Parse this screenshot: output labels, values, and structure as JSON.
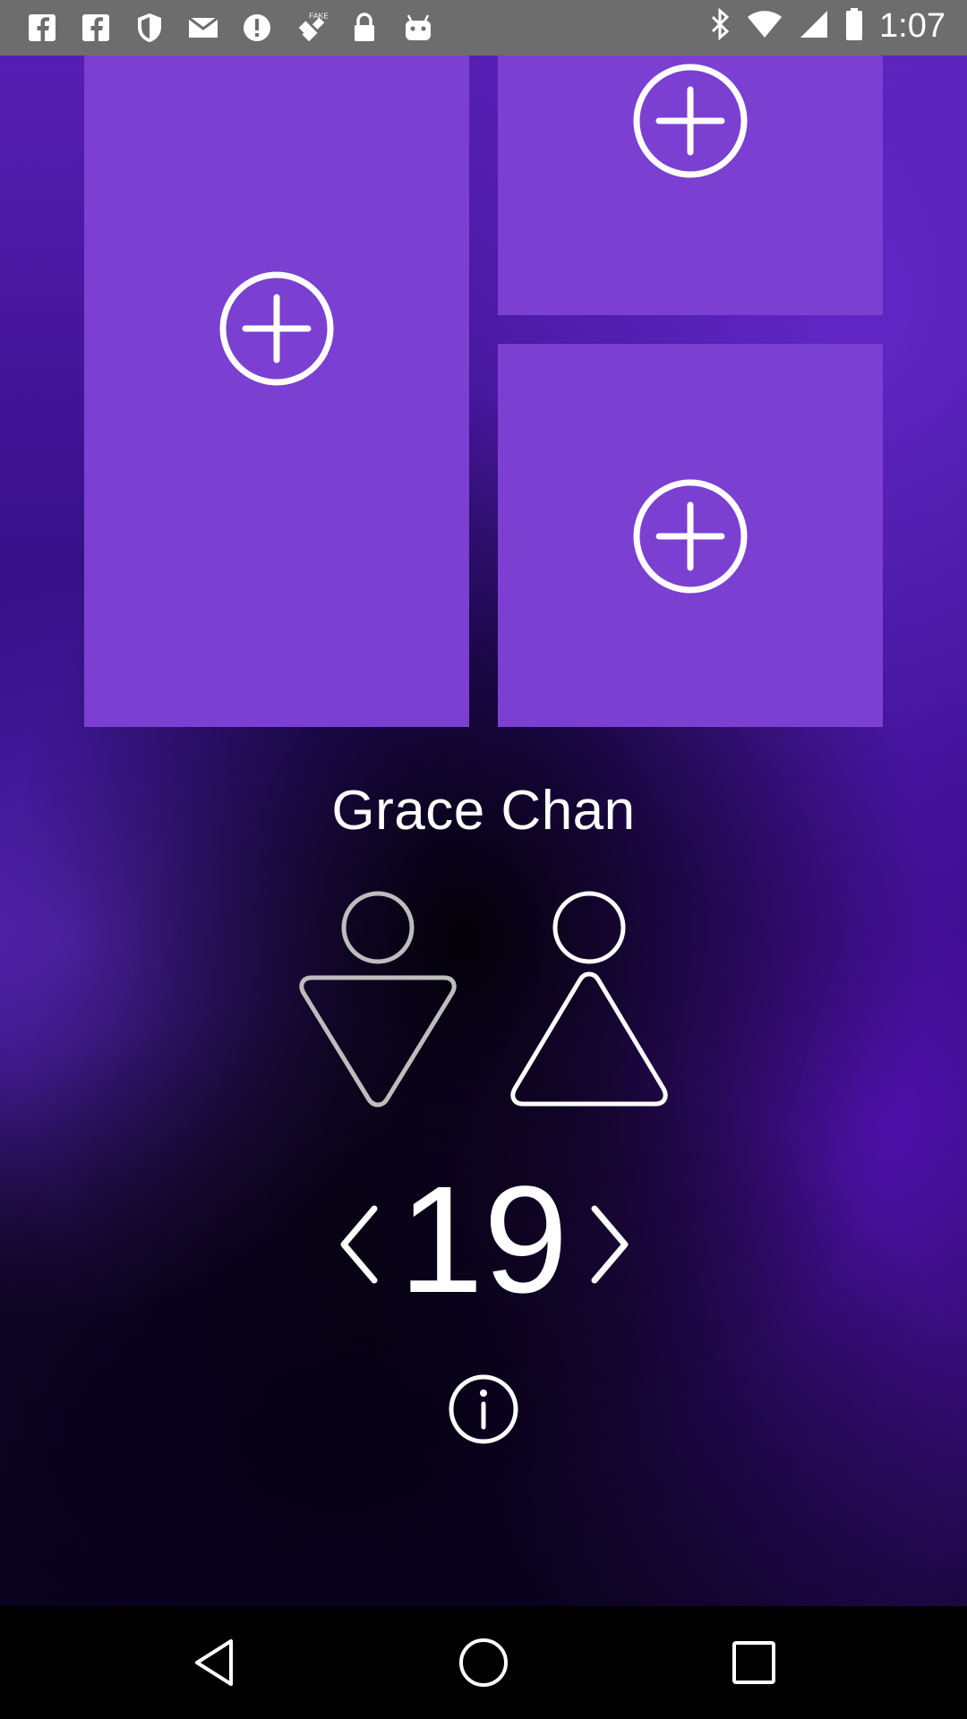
{
  "status_bar": {
    "time": "1:07",
    "left_icons": [
      "facebook-icon",
      "facebook-icon",
      "shield-icon",
      "mail-icon",
      "alert-icon",
      "fake-gps-icon",
      "lock-icon",
      "android-icon"
    ],
    "right_icons": [
      "bluetooth-icon",
      "wifi-icon",
      "signal-icon",
      "battery-icon"
    ]
  },
  "photos": {
    "slots": [
      "add-photo",
      "add-photo",
      "add-photo"
    ]
  },
  "profile": {
    "name": "Grace Chan",
    "gender_options": [
      "male",
      "female"
    ],
    "age": "19"
  },
  "colors": {
    "tile": "#7b3fd2",
    "text": "#ffffff",
    "status_bar": "#6d6d6d"
  },
  "nav": {
    "buttons": [
      "back",
      "home",
      "recent"
    ]
  }
}
